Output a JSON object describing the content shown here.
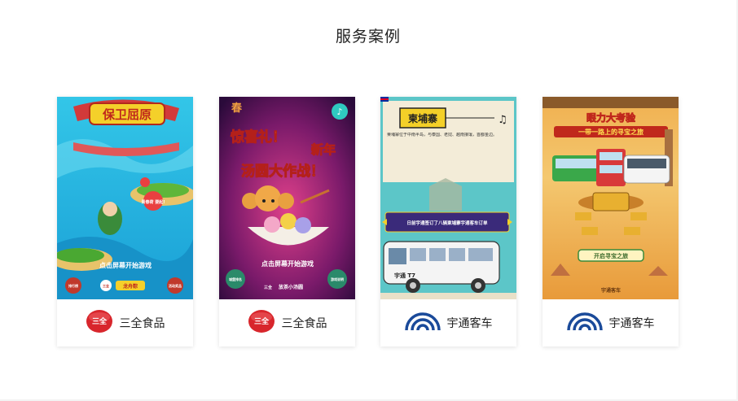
{
  "section": {
    "title": "服务案例"
  },
  "cases": [
    {
      "poster_title": "保卫屈原",
      "poster_cta": "点击屏幕开始游戏",
      "poster_badge": "青春荷 要起!",
      "poster_bottom": [
        "排行榜",
        "三全",
        "龙舟粽",
        "活动奖品"
      ],
      "brand_logo": "三全",
      "brand_name": "三全食品"
    },
    {
      "poster_title_1": "惊喜礼！",
      "poster_title_2": "新年",
      "poster_title_3": "汤圆大作战！",
      "poster_cta": "点击屏幕开始游戏",
      "poster_bottom": [
        "城堡排名",
        "三全",
        "放茶小汤圆",
        "游戏说明"
      ],
      "brand_logo": "三全",
      "brand_name": "三全食品"
    },
    {
      "poster_title": "柬埔寨",
      "poster_text": "柬埔寨位于中南半岛，与泰国、老挝、越南接壤，首都金边。",
      "poster_banner": "日前宇通签订了八辆柬埔寨宇通客车订单",
      "poster_bus_label": "宇通 T7",
      "brand_logo": "yutong-logo",
      "brand_name": "宇通客车"
    },
    {
      "poster_title_1": "眼力大考验",
      "poster_title_2": "一带一路上的寻宝之旅",
      "poster_button": "开启寻宝之旅",
      "poster_footer": "宇通客车",
      "brand_logo": "yutong-logo",
      "brand_name": "宇通客车"
    }
  ]
}
